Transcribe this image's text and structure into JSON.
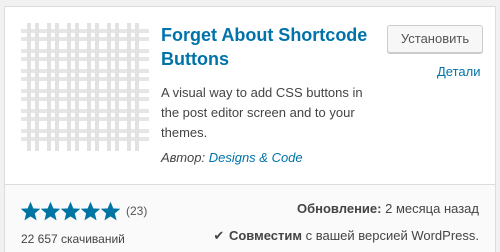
{
  "plugin": {
    "title": "Forget About Shortcode Buttons",
    "install_label": "Установить",
    "details_label": "Детали",
    "description": "A visual way to add CSS buttons in the post editor screen and to your themes.",
    "author_prefix": "Автор:",
    "author_name": "Designs & Code",
    "thumbnail_icon": "plaid-grid-icon"
  },
  "footer": {
    "stars_filled": 5,
    "stars_total": 5,
    "rating_count": "(23)",
    "downloads": "22 657 скачиваний",
    "updated_label": "Обновление:",
    "updated_value": "2 месяца назад",
    "compat_check": "✔",
    "compat_label": "Совместим",
    "compat_value": "с вашей версией WordPress."
  },
  "colors": {
    "link": "#0073aa",
    "star": "#0074a2",
    "thumb_lines": "#dcdcdc"
  }
}
